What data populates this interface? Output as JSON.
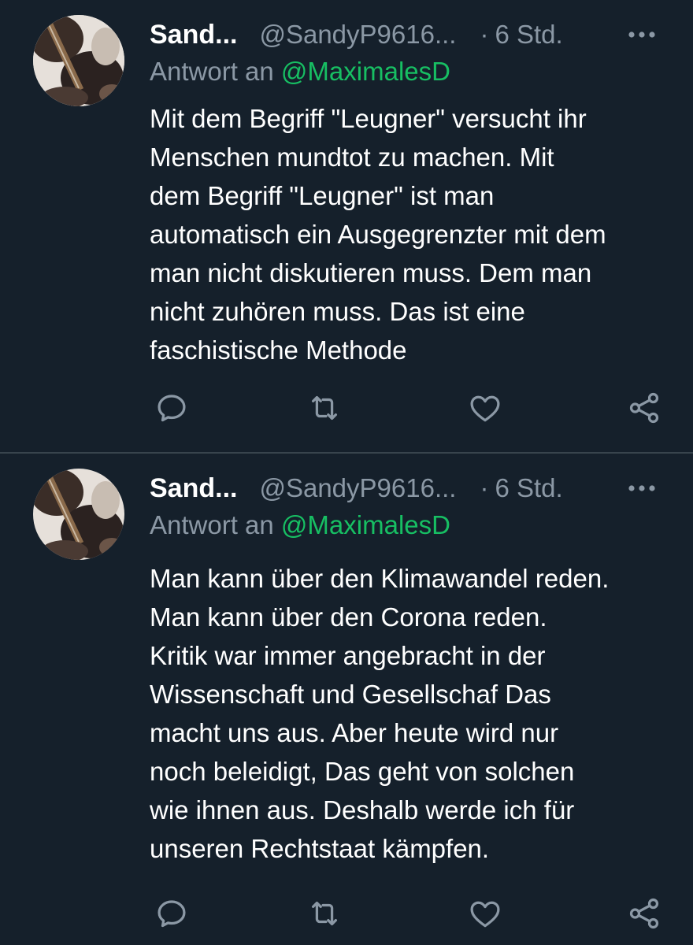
{
  "tweets": [
    {
      "name": "Sand...",
      "handle": "@SandyP9616...",
      "dot": "·",
      "time": "6 Std.",
      "reply_prefix": "Antwort an",
      "reply_mention": "@MaximalesD",
      "text": "Mit dem Begriff \"Leugner\" versucht ihr\nMenschen mundtot zu machen. Mit\ndem Begriff \"Leugner\" ist man\nautomatisch ein Ausgegrenzter mit dem\nman nicht diskutieren muss. Dem man\nnicht zuhören muss. Das ist eine\nfaschistische Methode"
    },
    {
      "name": "Sand...",
      "handle": "@SandyP9616...",
      "dot": "·",
      "time": "6 Std.",
      "reply_prefix": "Antwort an",
      "reply_mention": "@MaximalesD",
      "text": "Man kann über den Klimawandel reden.\nMan kann über den Corona reden.\nKritik war immer angebracht in der\nWissenschaft und Gesellschaf Das\nmacht uns aus. Aber heute wird nur\nnoch beleidigt, Das geht von solchen\nwie ihnen aus. Deshalb werde ich für\nunseren Rechtstaat kämpfen."
    }
  ],
  "icons": {
    "more": "more-icon",
    "reply": "reply-icon",
    "retweet": "retweet-icon",
    "like": "heart-icon",
    "share": "share-icon"
  },
  "colors": {
    "background": "#15202b",
    "secondary_text": "#8b98a5",
    "mention": "#17bf63",
    "divider": "#38444d"
  }
}
